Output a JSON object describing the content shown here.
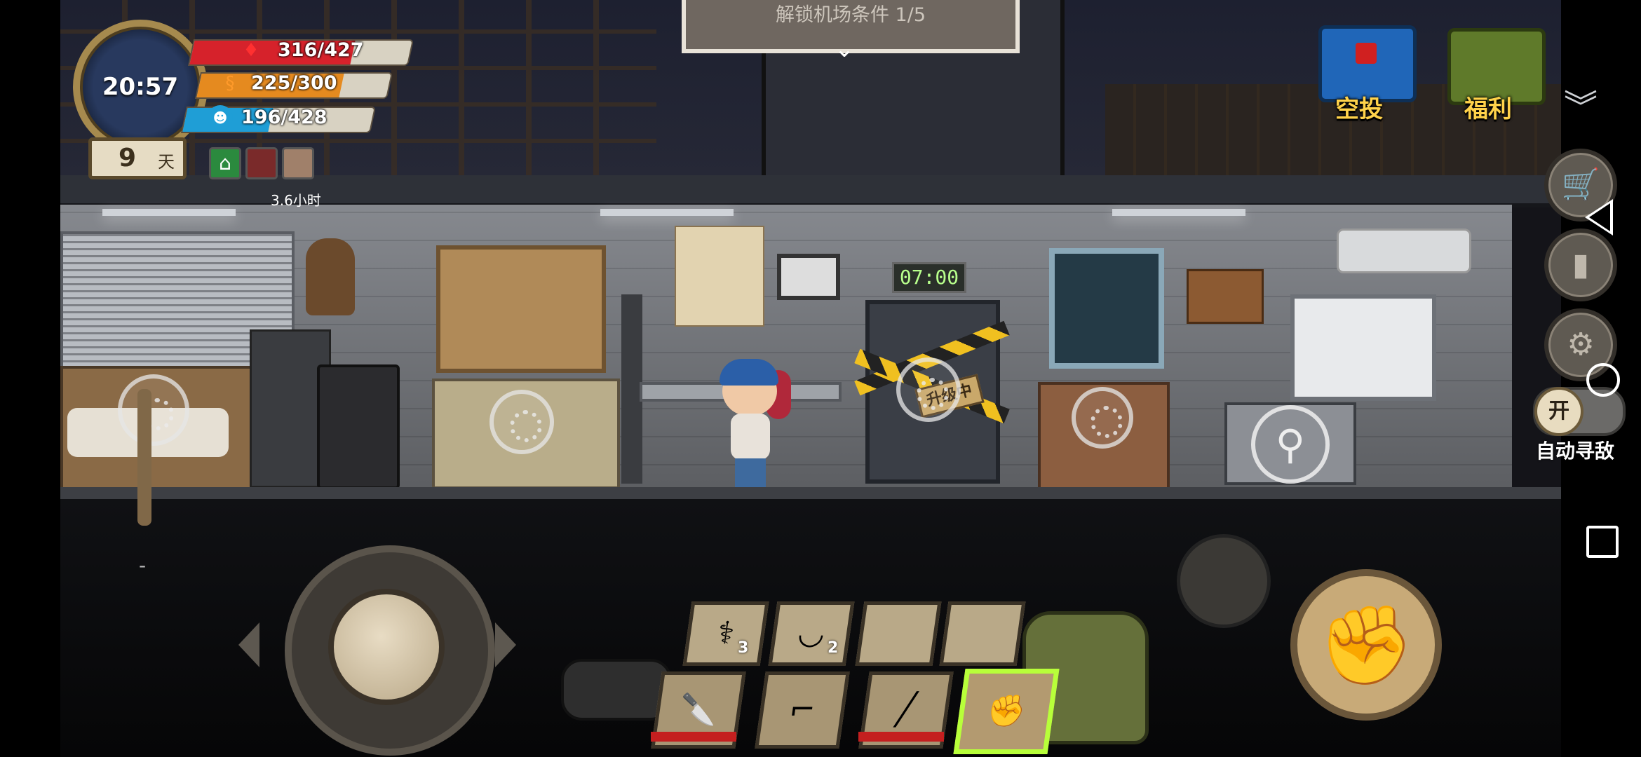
{
  "hud": {
    "clock": "20:57",
    "health": {
      "label": "316/427",
      "fill": 0.74,
      "color": "#d6222b",
      "icon": "blood-drop-icon"
    },
    "hunger": {
      "label": "225/300",
      "fill": 0.75,
      "color": "#e58a1f",
      "icon": "stomach-icon"
    },
    "mood": {
      "label": "196/428",
      "fill": 0.46,
      "color": "#1f9ed6",
      "icon": "brain-icon"
    },
    "day": {
      "number": "9",
      "unit": "天"
    },
    "status_timer": "3.6小时"
  },
  "top": {
    "unlock_text": "解锁机场条件 1/5",
    "airdrop_label": "空投",
    "welfare_label": "福利"
  },
  "room": {
    "clock_display": "07:00",
    "upgrade_sign": "升级中"
  },
  "controls": {
    "auto_toggle_label": "开",
    "auto_seek_label": "自动寻敌",
    "slider_minus": "-"
  },
  "inventory": {
    "consumables": [
      {
        "name": "medicine",
        "count": "3"
      },
      {
        "name": "soup",
        "count": "2"
      },
      {
        "name": "empty",
        "count": ""
      },
      {
        "name": "empty",
        "count": ""
      }
    ],
    "weapons": [
      "knife",
      "revolver",
      "spiked-bat",
      "fist"
    ]
  }
}
